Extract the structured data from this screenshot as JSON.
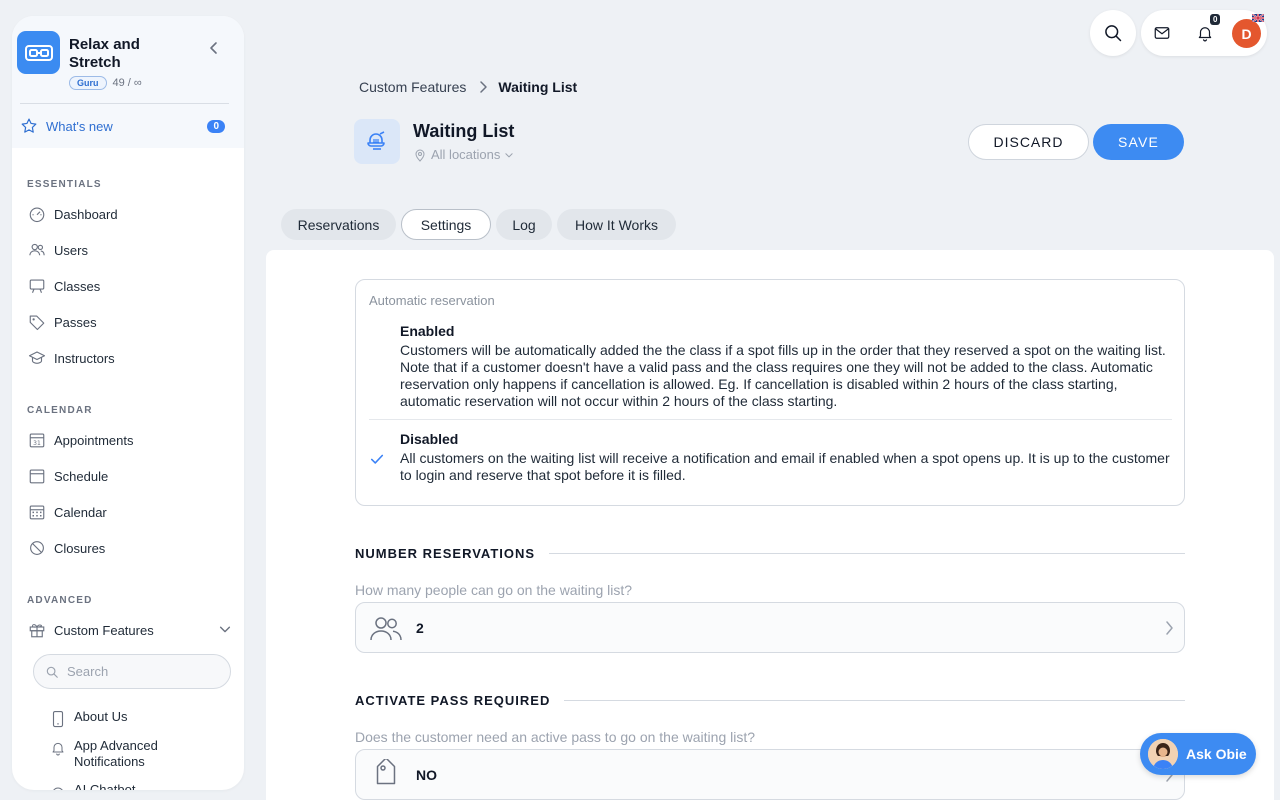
{
  "brand": {
    "name": "Relax and Stretch",
    "badge": "Guru",
    "count": "49 / ∞"
  },
  "whats_new": {
    "label": "What's new",
    "count": "0"
  },
  "sidebar": {
    "essentials_title": "ESSENTIALS",
    "essentials": [
      {
        "label": "Dashboard",
        "icon": "dashboard-icon"
      },
      {
        "label": "Users",
        "icon": "users-icon"
      },
      {
        "label": "Classes",
        "icon": "classes-icon"
      },
      {
        "label": "Passes",
        "icon": "tag-icon"
      },
      {
        "label": "Instructors",
        "icon": "graduation-cap-icon"
      }
    ],
    "calendar_title": "CALENDAR",
    "calendar": [
      {
        "label": "Appointments",
        "icon": "calendar-31-icon"
      },
      {
        "label": "Schedule",
        "icon": "calendar-icon"
      },
      {
        "label": "Calendar",
        "icon": "calendar-grid-icon"
      },
      {
        "label": "Closures",
        "icon": "prohibited-icon"
      }
    ],
    "advanced_title": "ADVANCED",
    "custom_features": {
      "label": "Custom Features",
      "icon": "gift-icon"
    },
    "search_placeholder": "Search",
    "sub_items": [
      {
        "label": "About Us",
        "icon": "phone-icon"
      },
      {
        "label": "App Advanced Notifications",
        "icon": "bell-icon"
      },
      {
        "label": "AI Chatbot",
        "icon": "chat-icon"
      }
    ]
  },
  "topbar": {
    "notifications_count": "0",
    "avatar_initial": "D"
  },
  "breadcrumb": {
    "parent": "Custom Features",
    "current": "Waiting List"
  },
  "header": {
    "title": "Waiting List",
    "location": "All locations",
    "discard_label": "DISCARD",
    "save_label": "SAVE"
  },
  "tabs": [
    {
      "label": "Reservations",
      "active": false
    },
    {
      "label": "Settings",
      "active": true
    },
    {
      "label": "Log",
      "active": false
    },
    {
      "label": "How It Works",
      "active": false
    }
  ],
  "automatic_reservation": {
    "label": "Automatic reservation",
    "options": [
      {
        "title": "Enabled",
        "description": "Customers will be automatically added the the class if a spot fills up in the order that they reserved a spot on the waiting list. Note that if a customer doesn't have a valid pass and the class requires one they will not be added to the class. Automatic reservation only happens if cancellation is allowed. Eg. If cancellation is disabled within 2 hours of the class starting, automatic reservation will not occur within 2 hours of the class starting.",
        "selected": false
      },
      {
        "title": "Disabled",
        "description": "All customers on the waiting list will receive a notification and email if enabled when a spot opens up. It is up to the customer to login and reserve that spot before it is filled.",
        "selected": true
      }
    ]
  },
  "number_reservations": {
    "title": "NUMBER RESERVATIONS",
    "question": "How many people can go on the waiting list?",
    "value": "2"
  },
  "activate_pass": {
    "title": "ACTIVATE PASS REQUIRED",
    "question": "Does the customer need an active pass to go on the waiting list?",
    "value": "NO"
  },
  "ask_obie": {
    "label": "Ask Obie"
  },
  "colors": {
    "accent": "#3d8bf2",
    "avatar": "#e4572e",
    "page_bg": "#eef1f5"
  }
}
